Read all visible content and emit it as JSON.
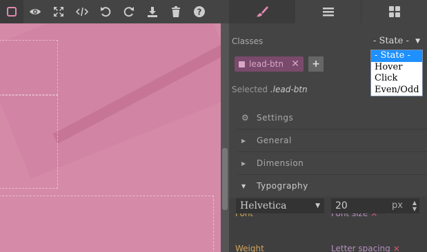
{
  "toolbar": {
    "buttons": [
      {
        "name": "sw-visibility-icon"
      },
      {
        "name": "preview-icon"
      },
      {
        "name": "fullscreen-icon"
      },
      {
        "name": "code-icon"
      },
      {
        "name": "undo-icon"
      },
      {
        "name": "redo-icon"
      },
      {
        "name": "download-icon"
      },
      {
        "name": "trash-icon"
      },
      {
        "name": "help-icon"
      }
    ]
  },
  "panel_tabs": [
    {
      "name": "style-manager-tab",
      "icon": "paint-brush-icon"
    },
    {
      "name": "layer-manager-tab",
      "icon": "bars-icon"
    },
    {
      "name": "blocks-tab",
      "icon": "grid-icon"
    }
  ],
  "selector": {
    "classes_label": "Classes",
    "state_value": "- State -",
    "state_options": [
      "- State -",
      "Hover",
      "Click",
      "Even/Odd"
    ],
    "tag_label": "lead-btn",
    "add_label": "+",
    "selected_prefix": "Selected",
    "selected_class": ".lead-btn"
  },
  "sectors": {
    "settings": "Settings",
    "general": "General",
    "dimension": "Dimension",
    "typography": "Typography"
  },
  "typography": {
    "font_label": "Font",
    "font_value": "Helvetica",
    "font_size_label": "Font size",
    "font_size_value": "20",
    "font_size_unit": "px",
    "weight_label": "Weight",
    "letter_spacing_label": "Letter spacing",
    "clear_symbol": "×"
  },
  "colors": {
    "accent": "#d58aa8",
    "tag_bg": "#7a4a6c",
    "label_gold": "#d2a35a",
    "label_pink": "#e35a7a"
  }
}
